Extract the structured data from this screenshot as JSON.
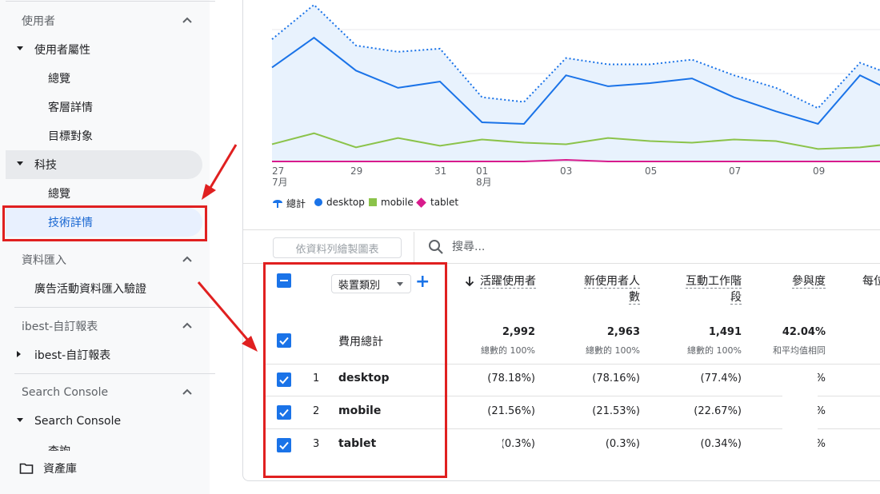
{
  "sidebar": {
    "section_users": "使用者",
    "user_attributes": "使用者屬性",
    "overview_1": "總覽",
    "demographics": "客層詳情",
    "audiences": "目標對象",
    "tech": "科技",
    "overview_2": "總覽",
    "tech_details": "技術詳情",
    "section_data_import": "資料匯入",
    "campaign_import": "廣告活動資料匯入驗證",
    "section_custom": "ibest-自訂報表",
    "custom_reports": "ibest-自訂報表",
    "section_search_console": "Search Console",
    "search_console": "Search Console",
    "queries_partial": "查詢",
    "library": "資產庫"
  },
  "chart_data": {
    "type": "line",
    "x_tick_labels": [
      "27",
      "29",
      "31",
      "01",
      "03",
      "05",
      "07",
      "09"
    ],
    "x_month_labels": [
      "7月",
      "8月"
    ],
    "legend": [
      "總計",
      "desktop",
      "mobile",
      "tablet"
    ],
    "series_colors": {
      "total": "#1a73e8",
      "desktop": "#1a73e8",
      "mobile": "#8bc34a",
      "tablet": "#d81b8c"
    },
    "grid": true,
    "series": [
      {
        "name": "總計",
        "values": [
          0.78,
          1.0,
          0.74,
          0.7,
          0.72,
          0.41,
          0.38,
          0.66,
          0.62,
          0.62,
          0.65,
          0.55,
          0.47,
          0.34,
          0.63,
          0.53
        ]
      },
      {
        "name": "desktop",
        "values": [
          0.6,
          0.79,
          0.58,
          0.47,
          0.51,
          0.25,
          0.24,
          0.55,
          0.48,
          0.5,
          0.53,
          0.41,
          0.32,
          0.24,
          0.55,
          0.42
        ]
      },
      {
        "name": "mobile",
        "values": [
          0.11,
          0.18,
          0.09,
          0.15,
          0.1,
          0.14,
          0.12,
          0.11,
          0.15,
          0.13,
          0.12,
          0.14,
          0.13,
          0.08,
          0.09,
          0.12
        ]
      },
      {
        "name": "tablet",
        "values": [
          0.0,
          0.0,
          0.0,
          0.0,
          0.0,
          0.0,
          0.0,
          0.01,
          0.0,
          0.0,
          0.0,
          0.0,
          0.0,
          0.0,
          0.0,
          0.0
        ]
      }
    ]
  },
  "toolbar": {
    "plot_rows": "依資料列繪製圖表",
    "search_placeholder": "搜尋..."
  },
  "table": {
    "dimension": "裝置類別",
    "headers": {
      "active_users": "活躍使用者",
      "new_users_1": "新使用者人",
      "new_users_2": "數",
      "engaged_sessions_1": "互動工作階",
      "engaged_sessions_2": "段",
      "engagement_rate": "參與度",
      "per_partial": "每位"
    },
    "totals": {
      "label": "費用總計",
      "active_users": "2,992",
      "active_users_sub": "總數的 100%",
      "new_users": "2,963",
      "new_users_sub": "總數的 100%",
      "engaged_sessions": "1,491",
      "engaged_sessions_sub": "總數的 100%",
      "engagement_rate": "42.04%",
      "engagement_rate_sub": "和平均值相同"
    },
    "rows": [
      {
        "idx": "1",
        "name": "desktop",
        "c1": "(78.18%)",
        "c2": "(78.16%)",
        "c3": "(77.4%)",
        "c4": "%"
      },
      {
        "idx": "2",
        "name": "mobile",
        "c1": "(21.56%)",
        "c2": "(21.53%)",
        "c3": "(22.67%)",
        "c4": "%"
      },
      {
        "idx": "3",
        "name": "tablet",
        "c1": "(0.3%)",
        "c2": "(0.3%)",
        "c3": "(0.34%)",
        "c4": "%"
      }
    ]
  }
}
